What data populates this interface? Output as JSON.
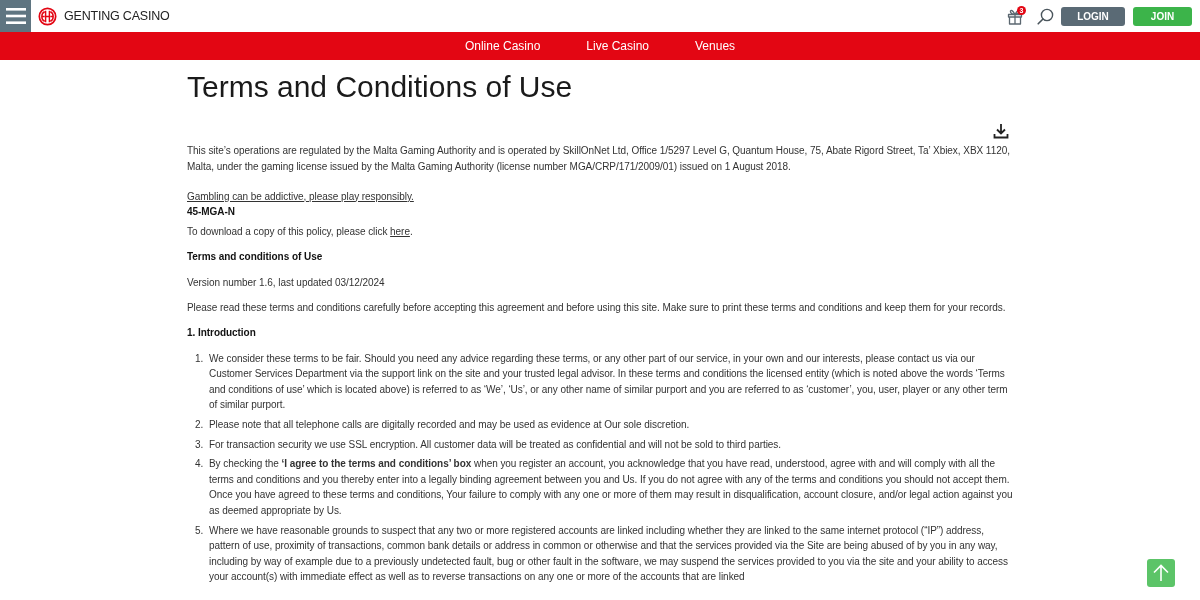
{
  "header": {
    "logo_text": "GENTING CASINO",
    "gift_badge": "3",
    "buttons": [
      {
        "label": "LOGIN",
        "kind": "login"
      },
      {
        "label": "JOIN",
        "kind": "join"
      }
    ]
  },
  "nav": {
    "items": [
      {
        "label": "Online Casino"
      },
      {
        "label": "Live Casino"
      },
      {
        "label": "Venues"
      }
    ]
  },
  "page": {
    "title": "Terms and Conditions of Use",
    "blocks": [
      {
        "kind": "paragraph",
        "text": "This site’s operations are regulated by the Malta Gaming Authority and is operated by SkillOnNet Ltd, Office 1/5297 Level G, Quantum House, 75, Abate Rigord Street, Ta’ Xbiex, XBX 1120, Malta, under the gaming license issued by the Malta Gaming Authority (license number MGA/CRP/171/2009/01) issued on 1 August 2018."
      },
      {
        "kind": "notice",
        "text": "Gambling can be addictive, please play responsibly."
      },
      {
        "kind": "code",
        "text": "45-MGA-N"
      },
      {
        "kind": "link_paragraph",
        "before": "To download a copy of this policy, please click ",
        "link": "here",
        "after": "."
      },
      {
        "kind": "heading",
        "text": "Terms and conditions of Use"
      },
      {
        "kind": "paragraph",
        "text": "Version number 1.6, last updated 03/12/2024"
      },
      {
        "kind": "paragraph",
        "text": "Please read these terms and conditions carefully before accepting this agreement and before using this site. Make sure to print these terms and conditions and keep them for your records."
      },
      {
        "kind": "heading",
        "text": "1. Introduction"
      },
      {
        "kind": "list",
        "items": [
          {
            "number": "1.",
            "text": "We consider these terms to be fair. Should you need any advice regarding these terms, or any other part of our service, in your own and our interests, please contact us via our Customer Services Department via the support link on the site and your trusted legal advisor. In these terms and conditions the licensed entity (which is noted above the words ‘Terms and conditions of use’ which is located above) is referred to as ‘We’, ‘Us’, or any other name of similar purport and you are referred to as ‘customer’, you, user, player or any other term of similar purport."
          },
          {
            "number": "2.",
            "text": "Please note that all telephone calls are digitally recorded and may be used as evidence at Our sole discretion."
          },
          {
            "number": "3.",
            "text": "For transaction security we use SSL encryption. All customer data will be treated as confidential and will not be sold to third parties."
          },
          {
            "number": "4.",
            "text": "By checking the **‘I agree to the terms and conditions’ box** when you register an account, you acknowledge that you have read, understood, agree with and will comply with all the terms and conditions and you thereby enter into a legally binding agreement between you and Us. If you do not agree with any of the terms and conditions you should not accept them. Once you have agreed to these terms and conditions, Your failure to comply with any one or more of them may result in disqualification, account closure, and/or legal action against you as deemed appropriate by Us."
          },
          {
            "number": "5.",
            "text": "Where we have reasonable grounds to suspect that any two or more registered accounts are linked including whether they are linked to the same internet protocol (“IP”) address, pattern of use, proximity of transactions, common bank details or address in common or otherwise and that the services provided via the Site are being abused of by you in any way, including by way of example due to a previously undetected fault, bug or other fault in the software, we may suspend the services provided to you via the site and your ability to access your account(s) with immediate effect as well as to reverse transactions on any one or more of the accounts that are linked"
          }
        ]
      }
    ]
  }
}
